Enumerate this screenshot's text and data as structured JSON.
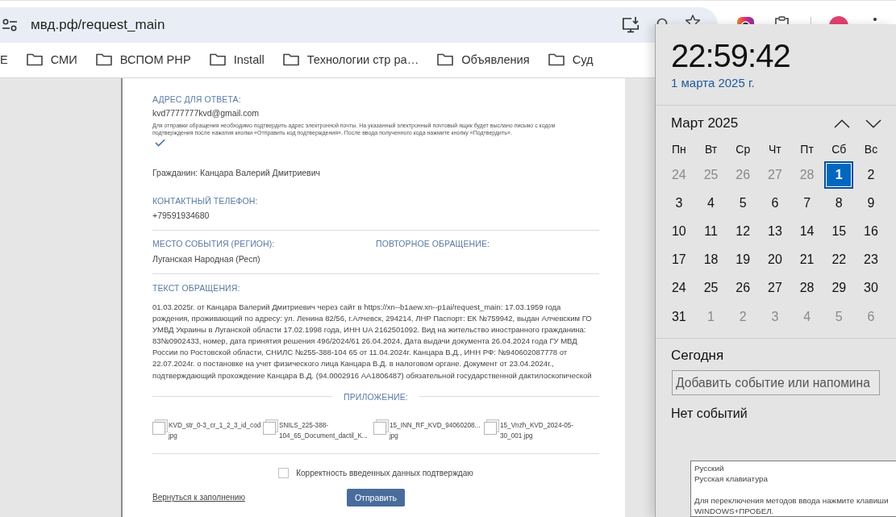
{
  "browser": {
    "url": "мвд.рф/request_main",
    "bookmarks": [
      {
        "kind": "plain",
        "label": "Е"
      },
      {
        "kind": "folder",
        "label": "СМИ"
      },
      {
        "kind": "folder",
        "label": "ВСПОМ PHP"
      },
      {
        "kind": "folder",
        "label": "Install"
      },
      {
        "kind": "folder",
        "label": "Технологии стр ра…"
      },
      {
        "kind": "folder",
        "label": "Объявления"
      },
      {
        "kind": "folder",
        "label": "Суд"
      }
    ]
  },
  "form": {
    "reply_address": {
      "label": "АДРЕС ДЛЯ ОТВЕТА:",
      "value": "kvd7777777kvd@gmail.com",
      "note": "Для отправки обращения необходимо подтвердить адрес электронной почты. На указанный электронный почтовый ящик будет выслано письмо с кодом подтверждения после нажатия кнопки «Отправить код подтверждения». После ввода полученного кода нажмите кнопку «Подтвердить».",
      "confirmed": true
    },
    "citizen": "Гражданин: Канцара Валерий Дмитриевич",
    "phone": {
      "label": "КОНТАКТНЫЙ ТЕЛЕФОН:",
      "value": "+79591934680"
    },
    "region": {
      "label": "МЕСТО СОБЫТИЯ (РЕГИОН):",
      "value": "Луганская Народная (Респ)"
    },
    "repeat_request": {
      "label": "ПОВТОРНОЕ ОБРАЩЕНИЕ:"
    },
    "message": {
      "label": "ТЕКСТ ОБРАЩЕНИЯ:",
      "text": "01.03.2025г. от Канцара Валерий Дмитриевич через сайт в https://xn--b1aew.xn--p1ai/request_main: 17.03.1959 года рождения, проживающий по адресу: ул. Ленина 82/56, г.Алчевск, 294214, ЛНР Паспорт: ЕК №759942, выдан Алчевским ГО УМВД Украины в Луганской области 17.02.1998 года, ИНН UA 2162501092. Вид на жительство иностранного гражданина: 83№0902433, номер, дата принятия решения 496/2024/61 26.04.2024, Дата выдачи документа 26.04.2024 года ГУ МВД России по Ростовской области, СНИЛС №255-388-104 65 от 11.04.2024г. Канцара В.Д., ИНН РФ: №940602087778 от 22.07.2024г. о постановке на учет физического лица Канцара В.Д. в налоговом органе. Документ от 23.04.2024г., подтверждающий прохождение Канцара В.Д. (94.0002916 АА1806487) обязательной государственной дактилоскопической"
    },
    "attachments": {
      "label": "ПРИЛОЖЕНИЕ:",
      "files": [
        {
          "name": "KVD_str_0-3_cr_1_2_3_id_cod\njpg"
        },
        {
          "name": "SNILS_225-388-\n104_65_Document_dactil_K..."
        },
        {
          "name": "15_INN_RF_KVD_94060208...\njpg"
        },
        {
          "name": "15_Vnzh_KVD_2024-05-\n30_001 jpg"
        }
      ]
    },
    "agreement": {
      "label": "Корректность введенных данных подтверждаю",
      "checked": false
    },
    "back_link": "Вернуться к заполнению",
    "submit_button": "Отправить"
  },
  "calendar_flyout": {
    "time": "22:59:42",
    "date": "1 марта 2025 г.",
    "month": "Март 2025",
    "weekdays": [
      "Пн",
      "Вт",
      "Ср",
      "Чт",
      "Пт",
      "Сб",
      "Вс"
    ],
    "weeks": [
      [
        {
          "day": "24",
          "in_month": false,
          "selected": false
        },
        {
          "day": "25",
          "in_month": false,
          "selected": false
        },
        {
          "day": "26",
          "in_month": false,
          "selected": false
        },
        {
          "day": "27",
          "in_month": false,
          "selected": false
        },
        {
          "day": "28",
          "in_month": false,
          "selected": false
        },
        {
          "day": "1",
          "in_month": true,
          "selected": true
        },
        {
          "day": "2",
          "in_month": true,
          "selected": false
        }
      ],
      [
        {
          "day": "3",
          "in_month": true,
          "selected": false
        },
        {
          "day": "4",
          "in_month": true,
          "selected": false
        },
        {
          "day": "5",
          "in_month": true,
          "selected": false
        },
        {
          "day": "6",
          "in_month": true,
          "selected": false
        },
        {
          "day": "7",
          "in_month": true,
          "selected": false
        },
        {
          "day": "8",
          "in_month": true,
          "selected": false
        },
        {
          "day": "9",
          "in_month": true,
          "selected": false
        }
      ],
      [
        {
          "day": "10",
          "in_month": true,
          "selected": false
        },
        {
          "day": "11",
          "in_month": true,
          "selected": false
        },
        {
          "day": "12",
          "in_month": true,
          "selected": false
        },
        {
          "day": "13",
          "in_month": true,
          "selected": false
        },
        {
          "day": "14",
          "in_month": true,
          "selected": false
        },
        {
          "day": "15",
          "in_month": true,
          "selected": false
        },
        {
          "day": "16",
          "in_month": true,
          "selected": false
        }
      ],
      [
        {
          "day": "17",
          "in_month": true,
          "selected": false
        },
        {
          "day": "18",
          "in_month": true,
          "selected": false
        },
        {
          "day": "19",
          "in_month": true,
          "selected": false
        },
        {
          "day": "20",
          "in_month": true,
          "selected": false
        },
        {
          "day": "21",
          "in_month": true,
          "selected": false
        },
        {
          "day": "22",
          "in_month": true,
          "selected": false
        },
        {
          "day": "23",
          "in_month": true,
          "selected": false
        }
      ],
      [
        {
          "day": "24",
          "in_month": true,
          "selected": false
        },
        {
          "day": "25",
          "in_month": true,
          "selected": false
        },
        {
          "day": "26",
          "in_month": true,
          "selected": false
        },
        {
          "day": "27",
          "in_month": true,
          "selected": false
        },
        {
          "day": "28",
          "in_month": true,
          "selected": false
        },
        {
          "day": "29",
          "in_month": true,
          "selected": false
        },
        {
          "day": "30",
          "in_month": true,
          "selected": false
        }
      ],
      [
        {
          "day": "31",
          "in_month": true,
          "selected": false
        },
        {
          "day": "1",
          "in_month": false,
          "selected": false
        },
        {
          "day": "2",
          "in_month": false,
          "selected": false
        },
        {
          "day": "3",
          "in_month": false,
          "selected": false
        },
        {
          "day": "4",
          "in_month": false,
          "selected": false
        },
        {
          "day": "5",
          "in_month": false,
          "selected": false
        },
        {
          "day": "6",
          "in_month": false,
          "selected": false
        }
      ]
    ],
    "today_heading": "Сегодня",
    "event_input": {
      "placeholder": "Добавить событие или напомина"
    },
    "no_events": "Нет событий"
  },
  "language_tooltip": {
    "language": "Русский",
    "layout": "Русская клавиатура",
    "hint": "Для переключения методов ввода нажмите клавиши WINDOWS+ПРОБЕЛ."
  }
}
